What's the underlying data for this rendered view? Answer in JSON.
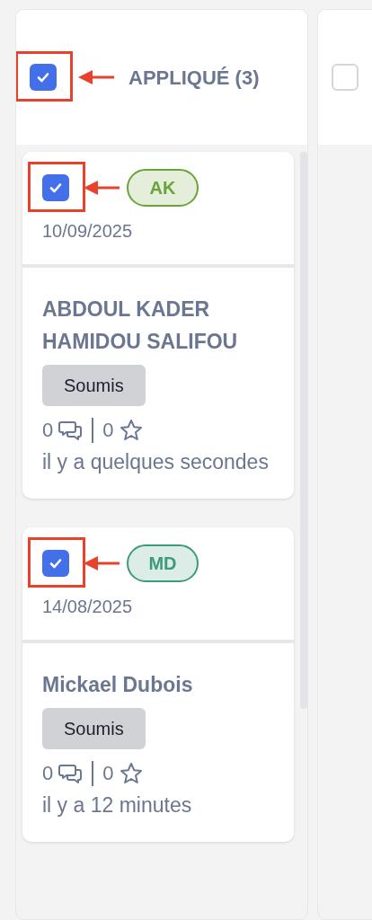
{
  "columns": [
    {
      "title": "APPLIQUÉ (3)",
      "checked": true,
      "annotated": true,
      "cards": [
        {
          "checked": true,
          "annotated": true,
          "initials": "AK",
          "color": "#6aa33a",
          "date": "10/09/2025",
          "name": "ABDOUL KADER HAMIDOU SALIFOU",
          "status": "Soumis",
          "comments": "0",
          "favorites": "0",
          "time": "il y a quelques secondes"
        },
        {
          "checked": true,
          "annotated": true,
          "initials": "MD",
          "color": "#3d9a7b",
          "date": "14/08/2025",
          "name": "Mickael Dubois",
          "status": "Soumis",
          "comments": "0",
          "favorites": "0",
          "time": "il y a 12 minutes"
        }
      ]
    },
    {
      "checked": false
    }
  ]
}
